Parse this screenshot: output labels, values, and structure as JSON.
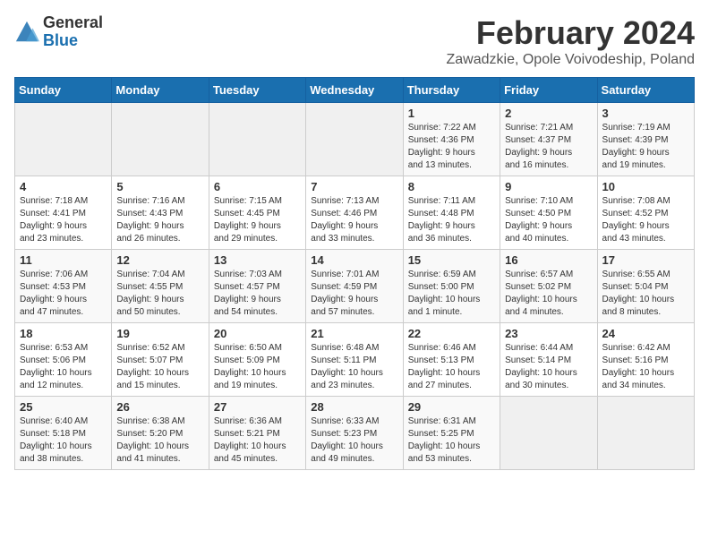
{
  "header": {
    "logo_general": "General",
    "logo_blue": "Blue",
    "title": "February 2024",
    "subtitle": "Zawadzkie, Opole Voivodeship, Poland"
  },
  "calendar": {
    "headers": [
      "Sunday",
      "Monday",
      "Tuesday",
      "Wednesday",
      "Thursday",
      "Friday",
      "Saturday"
    ],
    "rows": [
      [
        {
          "day": "",
          "info": ""
        },
        {
          "day": "",
          "info": ""
        },
        {
          "day": "",
          "info": ""
        },
        {
          "day": "",
          "info": ""
        },
        {
          "day": "1",
          "info": "Sunrise: 7:22 AM\nSunset: 4:36 PM\nDaylight: 9 hours\nand 13 minutes."
        },
        {
          "day": "2",
          "info": "Sunrise: 7:21 AM\nSunset: 4:37 PM\nDaylight: 9 hours\nand 16 minutes."
        },
        {
          "day": "3",
          "info": "Sunrise: 7:19 AM\nSunset: 4:39 PM\nDaylight: 9 hours\nand 19 minutes."
        }
      ],
      [
        {
          "day": "4",
          "info": "Sunrise: 7:18 AM\nSunset: 4:41 PM\nDaylight: 9 hours\nand 23 minutes."
        },
        {
          "day": "5",
          "info": "Sunrise: 7:16 AM\nSunset: 4:43 PM\nDaylight: 9 hours\nand 26 minutes."
        },
        {
          "day": "6",
          "info": "Sunrise: 7:15 AM\nSunset: 4:45 PM\nDaylight: 9 hours\nand 29 minutes."
        },
        {
          "day": "7",
          "info": "Sunrise: 7:13 AM\nSunset: 4:46 PM\nDaylight: 9 hours\nand 33 minutes."
        },
        {
          "day": "8",
          "info": "Sunrise: 7:11 AM\nSunset: 4:48 PM\nDaylight: 9 hours\nand 36 minutes."
        },
        {
          "day": "9",
          "info": "Sunrise: 7:10 AM\nSunset: 4:50 PM\nDaylight: 9 hours\nand 40 minutes."
        },
        {
          "day": "10",
          "info": "Sunrise: 7:08 AM\nSunset: 4:52 PM\nDaylight: 9 hours\nand 43 minutes."
        }
      ],
      [
        {
          "day": "11",
          "info": "Sunrise: 7:06 AM\nSunset: 4:53 PM\nDaylight: 9 hours\nand 47 minutes."
        },
        {
          "day": "12",
          "info": "Sunrise: 7:04 AM\nSunset: 4:55 PM\nDaylight: 9 hours\nand 50 minutes."
        },
        {
          "day": "13",
          "info": "Sunrise: 7:03 AM\nSunset: 4:57 PM\nDaylight: 9 hours\nand 54 minutes."
        },
        {
          "day": "14",
          "info": "Sunrise: 7:01 AM\nSunset: 4:59 PM\nDaylight: 9 hours\nand 57 minutes."
        },
        {
          "day": "15",
          "info": "Sunrise: 6:59 AM\nSunset: 5:00 PM\nDaylight: 10 hours\nand 1 minute."
        },
        {
          "day": "16",
          "info": "Sunrise: 6:57 AM\nSunset: 5:02 PM\nDaylight: 10 hours\nand 4 minutes."
        },
        {
          "day": "17",
          "info": "Sunrise: 6:55 AM\nSunset: 5:04 PM\nDaylight: 10 hours\nand 8 minutes."
        }
      ],
      [
        {
          "day": "18",
          "info": "Sunrise: 6:53 AM\nSunset: 5:06 PM\nDaylight: 10 hours\nand 12 minutes."
        },
        {
          "day": "19",
          "info": "Sunrise: 6:52 AM\nSunset: 5:07 PM\nDaylight: 10 hours\nand 15 minutes."
        },
        {
          "day": "20",
          "info": "Sunrise: 6:50 AM\nSunset: 5:09 PM\nDaylight: 10 hours\nand 19 minutes."
        },
        {
          "day": "21",
          "info": "Sunrise: 6:48 AM\nSunset: 5:11 PM\nDaylight: 10 hours\nand 23 minutes."
        },
        {
          "day": "22",
          "info": "Sunrise: 6:46 AM\nSunset: 5:13 PM\nDaylight: 10 hours\nand 27 minutes."
        },
        {
          "day": "23",
          "info": "Sunrise: 6:44 AM\nSunset: 5:14 PM\nDaylight: 10 hours\nand 30 minutes."
        },
        {
          "day": "24",
          "info": "Sunrise: 6:42 AM\nSunset: 5:16 PM\nDaylight: 10 hours\nand 34 minutes."
        }
      ],
      [
        {
          "day": "25",
          "info": "Sunrise: 6:40 AM\nSunset: 5:18 PM\nDaylight: 10 hours\nand 38 minutes."
        },
        {
          "day": "26",
          "info": "Sunrise: 6:38 AM\nSunset: 5:20 PM\nDaylight: 10 hours\nand 41 minutes."
        },
        {
          "day": "27",
          "info": "Sunrise: 6:36 AM\nSunset: 5:21 PM\nDaylight: 10 hours\nand 45 minutes."
        },
        {
          "day": "28",
          "info": "Sunrise: 6:33 AM\nSunset: 5:23 PM\nDaylight: 10 hours\nand 49 minutes."
        },
        {
          "day": "29",
          "info": "Sunrise: 6:31 AM\nSunset: 5:25 PM\nDaylight: 10 hours\nand 53 minutes."
        },
        {
          "day": "",
          "info": ""
        },
        {
          "day": "",
          "info": ""
        }
      ]
    ]
  }
}
